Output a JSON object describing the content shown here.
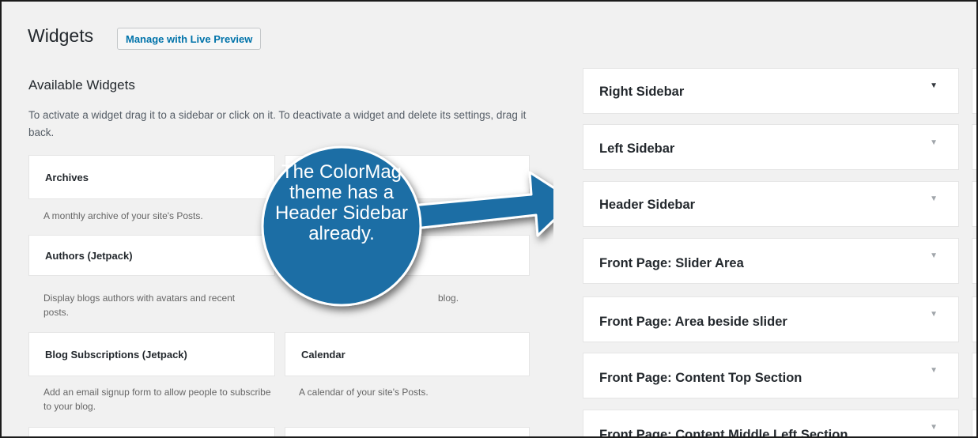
{
  "header": {
    "title": "Widgets",
    "live_preview_label": "Manage with Live Preview"
  },
  "available": {
    "title": "Available Widgets",
    "description": "To activate a widget drag it to a sidebar or click on it. To deactivate a widget and delete its settings, drag it back."
  },
  "widgets": [
    {
      "name": "Archives",
      "description": "A monthly archive of your site's Posts."
    },
    {
      "name": "Authors (Jetpack)",
      "description": "Display blogs authors with avatars and recent posts."
    },
    {
      "name": "Blog Subscriptions (Jetpack)",
      "description": "Add an email signup form to allow people to subscribe to your blog."
    },
    {
      "name": "Calendar",
      "description": "A calendar of your site's Posts."
    },
    {
      "name": "",
      "description": "blog."
    }
  ],
  "sidebars": [
    {
      "label": "Right Sidebar"
    },
    {
      "label": "Left Sidebar"
    },
    {
      "label": "Header Sidebar"
    },
    {
      "label": "Front Page: Slider Area"
    },
    {
      "label": "Front Page: Area beside slider"
    },
    {
      "label": "Front Page: Content Top Section"
    },
    {
      "label": "Front Page: Content Middle Left Section"
    }
  ],
  "callout": {
    "text": "The ColorMag theme has a Header Sidebar already.",
    "fill_color": "#1a6ea5",
    "border_color": "#ffffff"
  },
  "icons": {
    "toggle": "caret-down-icon",
    "glyph": "▼"
  }
}
